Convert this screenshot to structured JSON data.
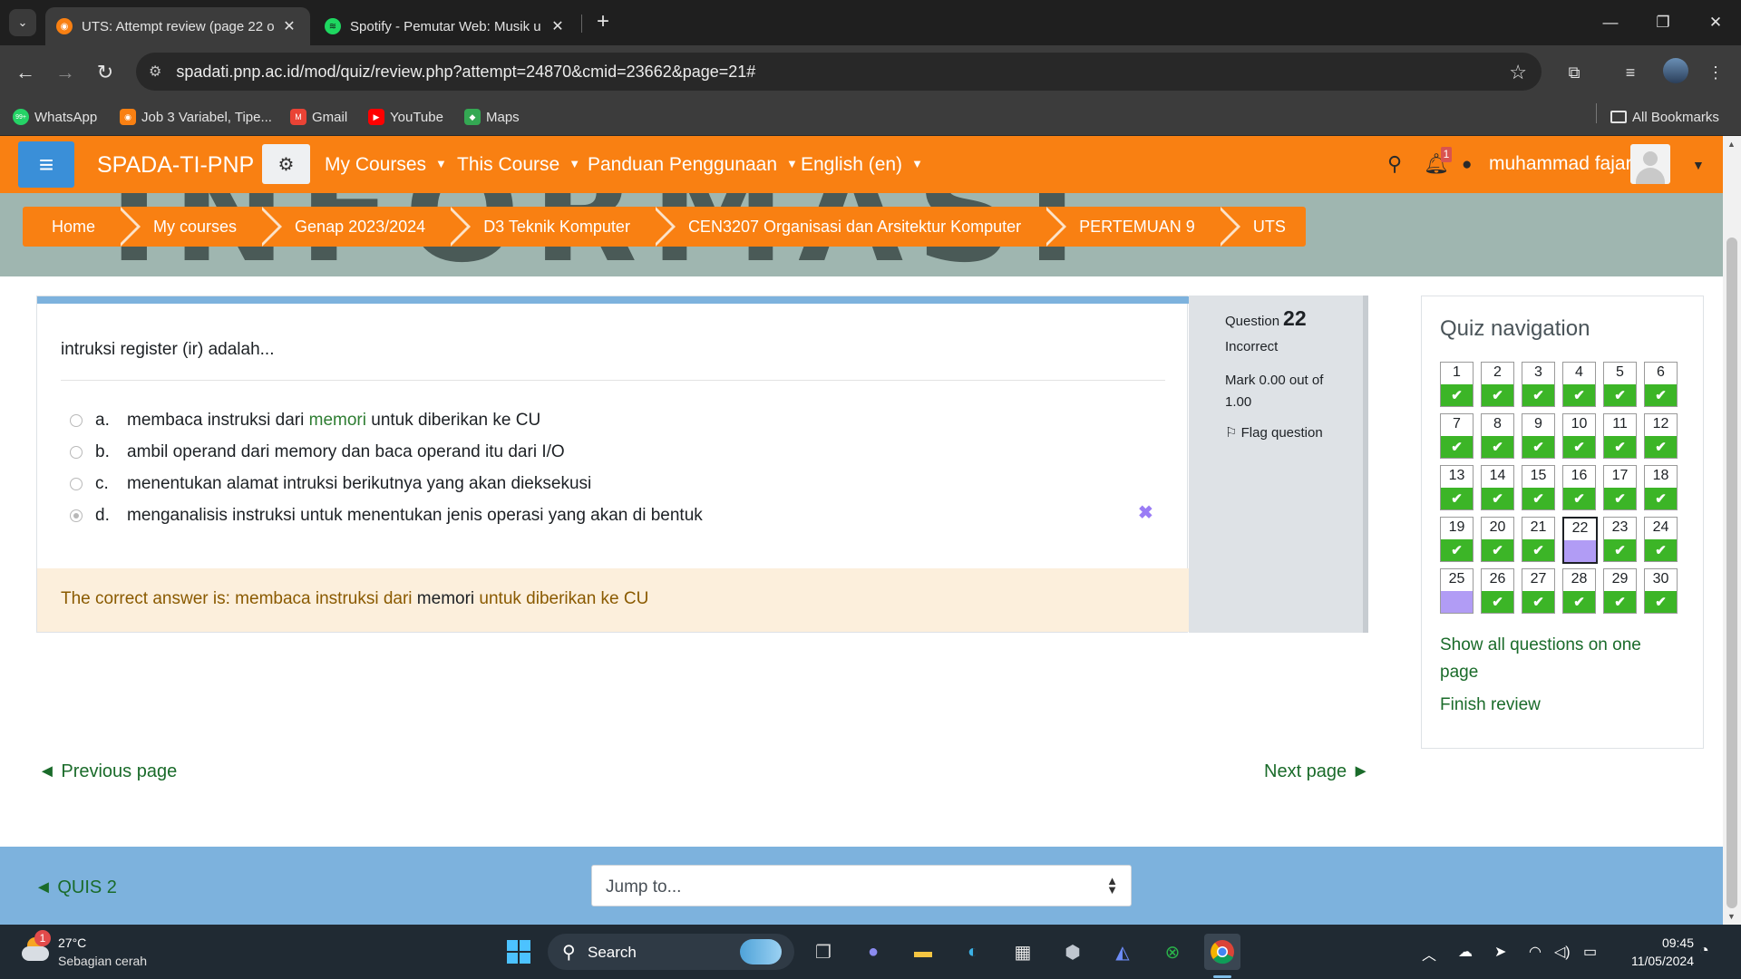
{
  "browser": {
    "tabs": [
      {
        "title": "UTS: Attempt review (page 22 o",
        "active": true
      },
      {
        "title": "Spotify - Pemutar Web: Musik u",
        "active": false
      }
    ],
    "url": "spadati.pnp.ac.id/mod/quiz/review.php?attempt=24870&cmid=23662&page=21#",
    "bookmarks": [
      {
        "label": "WhatsApp",
        "icon": "whatsapp-icon",
        "color": "#25d366"
      },
      {
        "label": "Job 3 Variabel, Tipe...",
        "icon": "moodle-icon",
        "color": "#f98012"
      },
      {
        "label": "Gmail",
        "icon": "gmail-icon",
        "color": "#ea4335"
      },
      {
        "label": "YouTube",
        "icon": "youtube-icon",
        "color": "#ff0000"
      },
      {
        "label": "Maps",
        "icon": "maps-icon",
        "color": "#34a853"
      }
    ],
    "all_bookmarks": "All Bookmarks",
    "whatsapp_badge": "99+"
  },
  "header": {
    "brand": "SPADA-TI-PNP",
    "menus": [
      "My Courses",
      "This Course",
      "Panduan Penggunaan",
      "English (en)"
    ],
    "notification_count": "1",
    "username": "muhammad fajar",
    "accent": "#f98012"
  },
  "banner_text": "INFORMASI",
  "breadcrumb": [
    "Home",
    "My courses",
    "Genap 2023/2024",
    "D3 Teknik Komputer",
    "CEN3207 Organisasi dan Arsitektur Komputer",
    "PERTEMUAN 9",
    "UTS"
  ],
  "question": {
    "text": "intruksi register (ir) adalah...",
    "answers": [
      {
        "letter": "a.",
        "before": "membaca instruksi dari ",
        "highlight": "memori",
        "after": " untuk diberikan ke CU",
        "selected": false
      },
      {
        "letter": "b.",
        "before": "ambil operand dari memory dan baca operand itu dari I/O",
        "highlight": "",
        "after": "",
        "selected": false
      },
      {
        "letter": "c.",
        "before": "menentukan alamat intruksi berikutnya yang akan dieksekusi",
        "highlight": "",
        "after": "",
        "selected": false
      },
      {
        "letter": "d.",
        "before": "menganalisis instruksi untuk menentukan jenis operasi yang akan di bentuk",
        "highlight": "",
        "after": "",
        "selected": true
      }
    ],
    "incorrect_mark": "✖",
    "feedback": {
      "prefix": "The correct answer is: membaca instruksi dari ",
      "highlight": "memori",
      "suffix": " untuk diberikan ke CU"
    }
  },
  "info": {
    "label": "Question",
    "number": "22",
    "state": "Incorrect",
    "mark": "Mark 0.00 out of 1.00",
    "flag": "Flag question"
  },
  "quiz_nav": {
    "title": "Quiz navigation",
    "current": 22,
    "questions": [
      {
        "n": "1",
        "s": "correct"
      },
      {
        "n": "2",
        "s": "correct"
      },
      {
        "n": "3",
        "s": "correct"
      },
      {
        "n": "4",
        "s": "correct"
      },
      {
        "n": "5",
        "s": "correct"
      },
      {
        "n": "6",
        "s": "correct"
      },
      {
        "n": "7",
        "s": "correct"
      },
      {
        "n": "8",
        "s": "correct"
      },
      {
        "n": "9",
        "s": "correct"
      },
      {
        "n": "10",
        "s": "correct"
      },
      {
        "n": "11",
        "s": "correct"
      },
      {
        "n": "12",
        "s": "correct"
      },
      {
        "n": "13",
        "s": "correct"
      },
      {
        "n": "14",
        "s": "correct"
      },
      {
        "n": "15",
        "s": "correct"
      },
      {
        "n": "16",
        "s": "correct"
      },
      {
        "n": "17",
        "s": "correct"
      },
      {
        "n": "18",
        "s": "correct"
      },
      {
        "n": "19",
        "s": "correct"
      },
      {
        "n": "20",
        "s": "correct"
      },
      {
        "n": "21",
        "s": "correct"
      },
      {
        "n": "22",
        "s": "incorrect"
      },
      {
        "n": "23",
        "s": "correct"
      },
      {
        "n": "24",
        "s": "correct"
      },
      {
        "n": "25",
        "s": "incorrect"
      },
      {
        "n": "26",
        "s": "correct"
      },
      {
        "n": "27",
        "s": "correct"
      },
      {
        "n": "28",
        "s": "correct"
      },
      {
        "n": "29",
        "s": "correct"
      },
      {
        "n": "30",
        "s": "correct"
      }
    ],
    "show_all": "Show all questions on one page",
    "finish": "Finish review"
  },
  "paging": {
    "previous": "◄ Previous page",
    "next": "Next page ►"
  },
  "footer": {
    "prev_activity": "◄ QUIS 2",
    "jump_label": "Jump to..."
  },
  "taskbar": {
    "weather_badge": "1",
    "temp": "27°C",
    "condition": "Sebagian cerah",
    "search_label": "Search",
    "time": "09:45",
    "date": "11/05/2024"
  }
}
